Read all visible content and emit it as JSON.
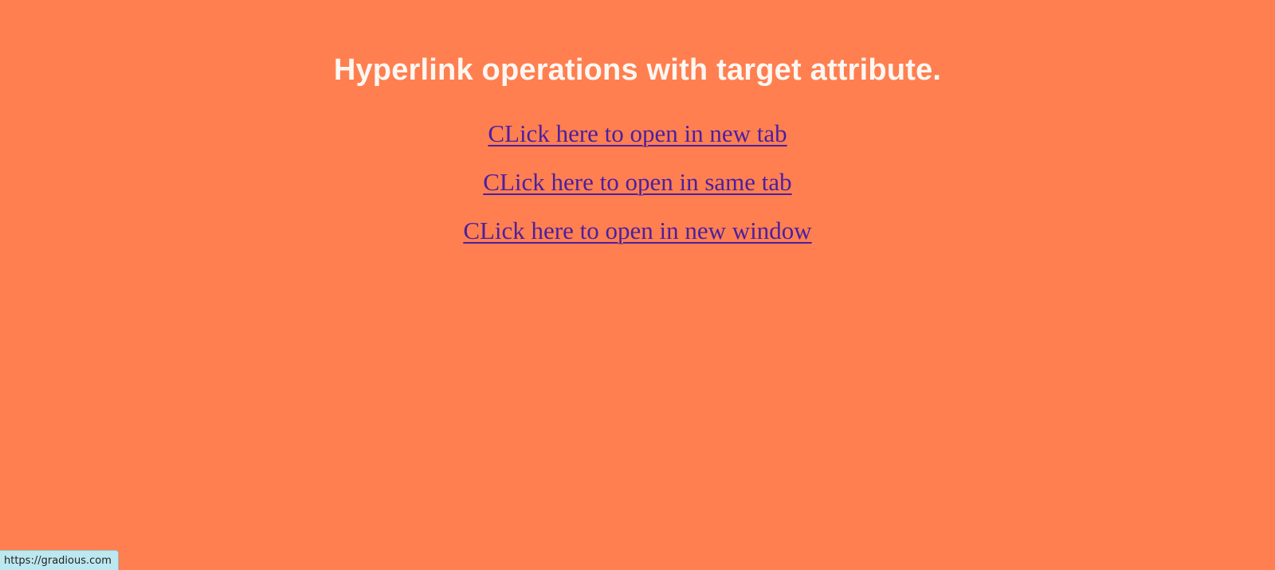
{
  "page": {
    "background_color": "#ff7f50",
    "heading": "Hyperlink operations with target attribute.",
    "heading_color": "#fdf7f2",
    "link_color": "#4b1fa0"
  },
  "links": [
    {
      "label": "CLick here to open in new tab"
    },
    {
      "label": "CLick here to open in same tab"
    },
    {
      "label": "CLick here to open in new window"
    }
  ],
  "status_bar": {
    "url": "https://gradious.com"
  }
}
